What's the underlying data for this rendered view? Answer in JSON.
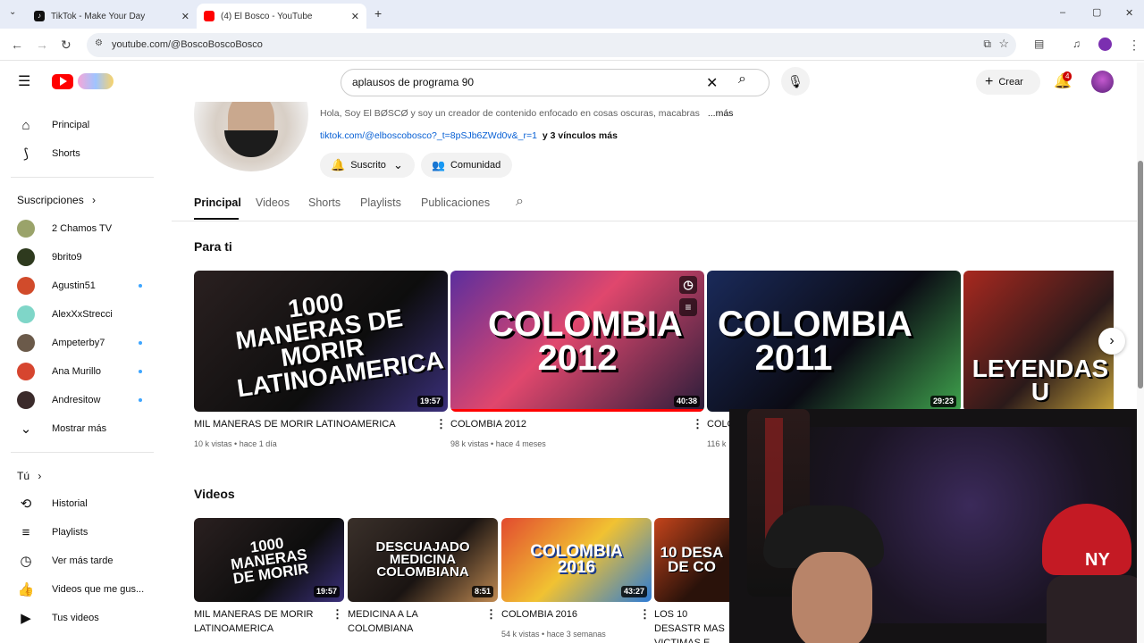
{
  "browser": {
    "tabs": [
      {
        "label": "TikTok - Make Your Day",
        "active": false,
        "icon": "tiktok-icon"
      },
      {
        "label": "(4) El Bosco - YouTube",
        "active": true,
        "icon": "youtube-icon"
      }
    ],
    "new_tab": "+",
    "url": "youtube.com/@BoscoBoscoBosco",
    "window_controls": [
      "–",
      "▢",
      "✕"
    ]
  },
  "header": {
    "search_value": "aplausos de programa 90",
    "create_label": "Crear",
    "notification_count": "4",
    "colors": {
      "brand": "#ff0000",
      "badge": "#cc0000"
    }
  },
  "sidebar": {
    "main_items": [
      {
        "label": "Principal",
        "icon": "home-icon"
      },
      {
        "label": "Shorts",
        "icon": "shorts-icon"
      }
    ],
    "subscriptions_header": "Suscripciones",
    "subscriptions": [
      {
        "label": "2 Chamos TV",
        "color": "#9aa36a",
        "new": false
      },
      {
        "label": "9brito9",
        "color": "#2e3a1e",
        "new": false
      },
      {
        "label": "Agustin51",
        "color": "#d14b2b",
        "new": true
      },
      {
        "label": "AlexXxStrecci",
        "color": "#7fd6c8",
        "new": false
      },
      {
        "label": "Ampeterby7",
        "color": "#6b5a4a",
        "new": true
      },
      {
        "label": "Ana Murillo",
        "color": "#d6452f",
        "new": true
      },
      {
        "label": "Andresitow",
        "color": "#3b2b2b",
        "new": true
      }
    ],
    "show_more": "Mostrar más",
    "you_header": "Tú",
    "you_items": [
      {
        "label": "Historial",
        "icon": "history-icon"
      },
      {
        "label": "Playlists",
        "icon": "playlists-icon"
      },
      {
        "label": "Ver más tarde",
        "icon": "watch-later-icon"
      },
      {
        "label": "Videos que me gus...",
        "icon": "thumbs-up-icon"
      },
      {
        "label": "Tus videos",
        "icon": "your-videos-icon"
      }
    ]
  },
  "channel": {
    "description": "Hola, Soy El BØSCØ y soy un creador de contenido enfocado en cosas oscuras, macabras",
    "more": "...más",
    "link": "tiktok.com/@elboscobosco?_t=8pSJb6ZWd0v&_r=1",
    "link_extra": "y 3 vínculos más",
    "subscribed_label": "Suscrito",
    "community_label": "Comunidad",
    "tabs": [
      "Principal",
      "Videos",
      "Shorts",
      "Playlists",
      "Publicaciones"
    ],
    "active_tab": "Principal"
  },
  "for_you": {
    "heading": "Para ti",
    "videos": [
      {
        "thumb_text": "1000 MANERAS DE MORIR LATINOAMERICA",
        "duration": "19:57",
        "title": "MIL MANERAS DE MORIR LATINOAMERICA",
        "views": "10 k vistas",
        "age": "hace 1 día",
        "bg": "#1d1a1a"
      },
      {
        "thumb_text": "COLOMBIA 2012",
        "duration": "40:38",
        "title": "COLOMBIA 2012",
        "views": "98 k vistas",
        "age": "hace 4 meses",
        "bg": "#3b2a55"
      },
      {
        "thumb_text": "COLOMBIA 2011",
        "duration": "29:23",
        "title": "COLO",
        "views": "116 k",
        "age": "",
        "bg": "#1c2238"
      },
      {
        "thumb_text": "LEYENDAS U",
        "duration": "",
        "title": "",
        "views": "",
        "age": "",
        "bg": "#8a1c1c"
      }
    ]
  },
  "videos_section": {
    "heading": "Videos",
    "videos": [
      {
        "thumb_text": "1000 MANERAS DE MORIR",
        "duration": "19:57",
        "title": "MIL MANERAS DE MORIR LATINOAMERICA",
        "views": "",
        "age": "",
        "bg": "#1d1a1a"
      },
      {
        "thumb_text": "DESCUAJADO MEDICINA COLOMBIANA",
        "duration": "8:51",
        "title": "MEDICINA A LA COLOMBIANA",
        "views": "",
        "age": "",
        "bg": "#2a2420"
      },
      {
        "thumb_text": "COLOMBIA 2016",
        "duration": "43:27",
        "title": "COLOMBIA 2016",
        "views": "54 k vistas",
        "age": "hace 3 semanas",
        "bg": "#c23a2a"
      },
      {
        "thumb_text": "10 DESA DE CO",
        "duration": "",
        "title": "LOS 10 DESASTR MAS VICTIMAS E",
        "views": "",
        "age": "",
        "bg": "#5a2410"
      }
    ]
  }
}
